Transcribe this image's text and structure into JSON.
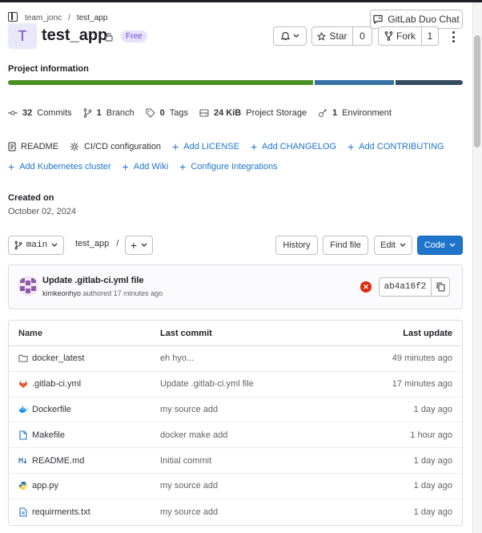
{
  "breadcrumb": {
    "group": "team_jonc",
    "separator": "/",
    "project": "test_app"
  },
  "header": {
    "duo_chat_label": "GitLab Duo Chat"
  },
  "project": {
    "avatar_letter": "T",
    "name": "test_app",
    "tier_badge": "Free",
    "star_label": "Star",
    "star_count": "0",
    "fork_label": "Fork",
    "fork_count": "1"
  },
  "project_info": {
    "title": "Project information",
    "language_bar": [
      {
        "fraction": 0.675,
        "color": "#4c8f24"
      },
      {
        "fraction": 0.177,
        "color": "#3672a4"
      },
      {
        "fraction": 0.148,
        "color": "#354b5e"
      }
    ],
    "stats": [
      {
        "icon": "commit-icon",
        "value": "32",
        "label": "Commits"
      },
      {
        "icon": "branch-icon",
        "value": "1",
        "label": "Branch"
      },
      {
        "icon": "tag-icon",
        "value": "0",
        "label": "Tags"
      },
      {
        "icon": "storage-icon",
        "value": "24 KiB",
        "label": "Project Storage"
      },
      {
        "icon": "environment-icon",
        "value": "1",
        "label": "Environment"
      }
    ],
    "links_row1": [
      {
        "icon": "readme-icon",
        "label": "README",
        "add": false
      },
      {
        "icon": "cicd-icon",
        "label": "CI/CD configuration",
        "add": false
      },
      {
        "icon": "plus-icon",
        "label": "Add LICENSE",
        "add": true
      },
      {
        "icon": "plus-icon",
        "label": "Add CHANGELOG",
        "add": true
      },
      {
        "icon": "plus-icon",
        "label": "Add CONTRIBUTING",
        "add": true
      }
    ],
    "links_row2": [
      {
        "icon": "plus-icon",
        "label": "Add Kubernetes cluster",
        "add": true
      },
      {
        "icon": "plus-icon",
        "label": "Add Wiki",
        "add": true
      },
      {
        "icon": "plus-icon",
        "label": "Configure Integrations",
        "add": true
      }
    ],
    "created_label": "Created on",
    "created_date": "October 02, 2024"
  },
  "repo_toolbar": {
    "branch": "main",
    "path": "test_app",
    "path_sep": "/",
    "history": "History",
    "find_file": "Find file",
    "edit": "Edit",
    "code": "Code"
  },
  "last_commit": {
    "title": "Update .gitlab-ci.yml file",
    "author": "kimkeonhyo",
    "authored_text": "authored 17 minutes ago",
    "sha": "ab4a16f2"
  },
  "file_table": {
    "headers": {
      "name": "Name",
      "last_commit": "Last commit",
      "last_update": "Last update"
    },
    "rows": [
      {
        "icon": "folder-icon",
        "name": "docker_latest",
        "commit": "eh hyo...",
        "updated": "49 minutes ago"
      },
      {
        "icon": "gitlab-icon",
        "name": ".gitlab-ci.yml",
        "commit": "Update .gitlab-ci.yml file",
        "updated": "17 minutes ago"
      },
      {
        "icon": "docker-icon",
        "name": "Dockerfile",
        "commit": "my source add",
        "updated": "1 day ago"
      },
      {
        "icon": "file-icon",
        "name": "Makefile",
        "commit": "docker make add",
        "updated": "1 hour ago"
      },
      {
        "icon": "markdown-icon",
        "name": "README.md",
        "commit": "Initial commit",
        "updated": "1 day ago"
      },
      {
        "icon": "python-icon",
        "name": "app.py",
        "commit": "my source add",
        "updated": "1 day ago"
      },
      {
        "icon": "text-file-icon",
        "name": "requirments.txt",
        "commit": "my source add",
        "updated": "1 day ago"
      }
    ]
  }
}
